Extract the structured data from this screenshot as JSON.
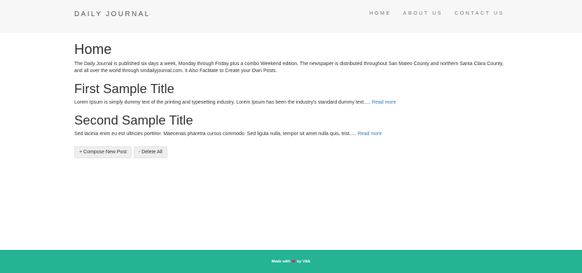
{
  "navbar": {
    "brand": "DAILY JOURNAL",
    "links": [
      "HOME",
      "ABOUT US",
      "CONTACT US"
    ]
  },
  "home": {
    "title": "Home",
    "intro": "The Daily Journal is published six days a week, Monday through Friday plus a combo Weekend edition. The newspaper is distributed throughout San Mateo County and northern Santa Clara County, and all over the world through smdailyjournal.com. It Also Faclitate to Create your Own Posts."
  },
  "posts": [
    {
      "title": "First Sample Title",
      "excerpt": "Lorem Ipsum is simply dummy text of the printing and typesetting industry. Lorem Ipsum has been the industry's standard dummy text.....",
      "read_more": "Read more"
    },
    {
      "title": "Second Sample Title",
      "excerpt": "Sed lacinia enim eu est ultricies porttitor. Maecenas pharetra cursus commodo. Sed ligula nulla, tempor sit amet nulla quis, trist.....",
      "read_more": "Read more"
    }
  ],
  "actions": {
    "compose": "+ Compose New Post",
    "delete_all": "- Delete All"
  },
  "footer": {
    "made_with": "Made with",
    "by": "by Vikk",
    "heart_icon": "heart-icon",
    "heart_color": "#e0245e",
    "background_color": "#24b494"
  }
}
